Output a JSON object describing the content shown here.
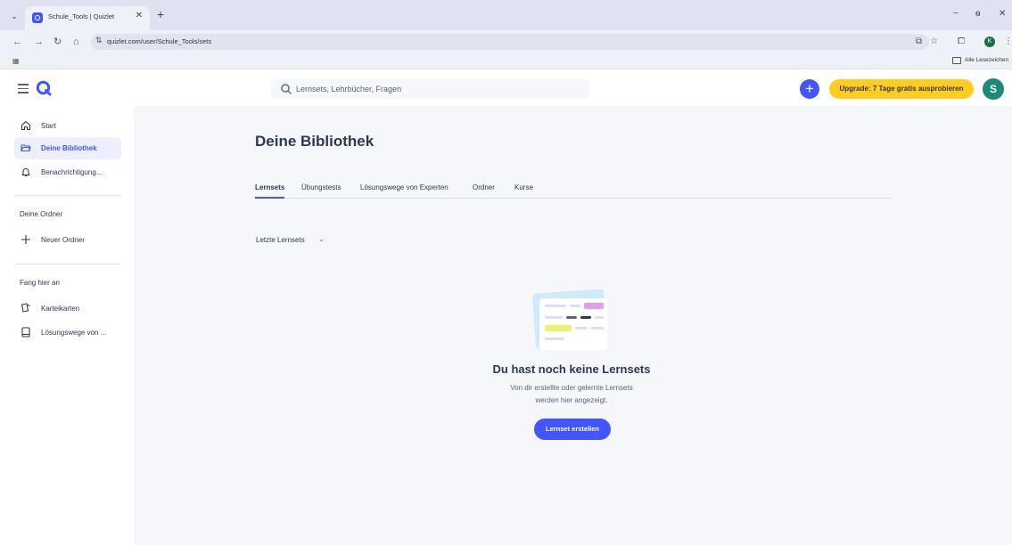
{
  "browser": {
    "tab_title": "Schule_Tools | Quizlet",
    "tab_menu": "⌄",
    "tab_close": "✕",
    "new_tab": "+",
    "url": "quizlet.com/user/Schule_Tools/sets",
    "bookmarks_label": "Alle Lesezeichen",
    "profile_initial": "K",
    "minimize": "−",
    "restore": "ɵ",
    "close": "✕"
  },
  "header": {
    "search_placeholder": "Lernsets, Lehrbücher, Fragen",
    "plus_label": "+",
    "upgrade_label": "Upgrade: 7 Tage gratis ausprobieren",
    "avatar_initial": "S"
  },
  "sidebar": {
    "items": [
      {
        "label": "Start",
        "icon": "home-icon"
      },
      {
        "label": "Deine Bibliothek",
        "icon": "folder-open-icon"
      },
      {
        "label": "Benachrichtigung...",
        "icon": "bell-icon"
      }
    ],
    "folders_heading": "Deine Ordner",
    "new_folder_label": "Neuer Ordner",
    "start_heading": "Fang hier an",
    "start_items": [
      {
        "label": "Karteikarten",
        "icon": "flashcards-icon"
      },
      {
        "label": "Lösungswege von ...",
        "icon": "book-icon"
      }
    ]
  },
  "main": {
    "title": "Deine Bibliothek",
    "tabs": [
      "Lernsets",
      "Übungstests",
      "Lösungswege von Experten",
      "Ordner",
      "Kurse"
    ],
    "active_tab": "Lernsets",
    "filter_label": "Letzte Lernsets",
    "empty_title": "Du hast noch keine Lernsets",
    "empty_line1": "Von dir erstellte oder gelernte Lernsets",
    "empty_line2": "werden hier angezeigt.",
    "create_button": "Lernset erstellen"
  },
  "colors": {
    "brand": "#4255ff",
    "upgrade": "#ffcd1f",
    "avatar": "#1b8a7a",
    "background": "#f6f7fb"
  }
}
